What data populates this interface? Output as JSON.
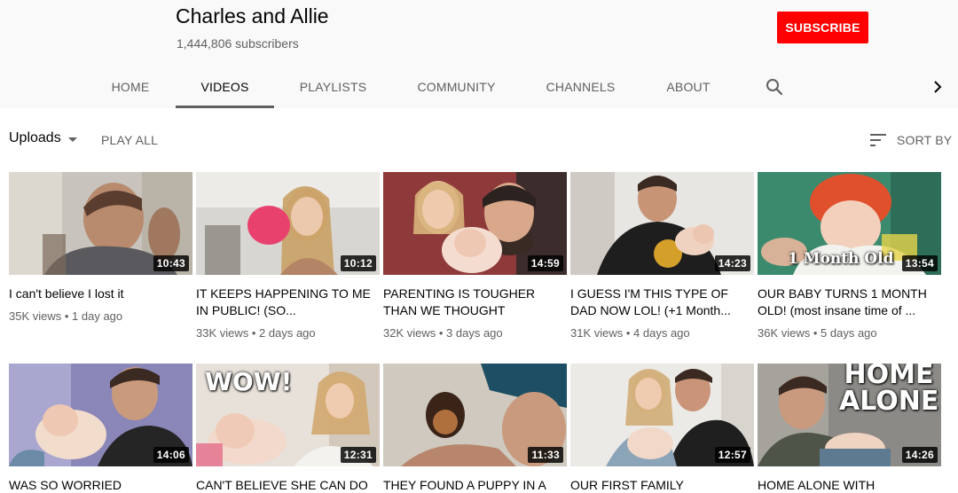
{
  "channel": {
    "name": "Charles and Allie",
    "subscribers": "1,444,806 subscribers",
    "subscribe_label": "SUBSCRIBE"
  },
  "tabs": [
    {
      "label": "HOME"
    },
    {
      "label": "VIDEOS"
    },
    {
      "label": "PLAYLISTS"
    },
    {
      "label": "COMMUNITY"
    },
    {
      "label": "CHANNELS"
    },
    {
      "label": "ABOUT"
    }
  ],
  "icons": {
    "search": "search-icon",
    "next": "chevron-right-icon",
    "sort": "sort-icon",
    "dropdown": "caret-down-icon"
  },
  "toolbar": {
    "uploads_label": "Uploads",
    "play_all_label": "PLAY ALL",
    "sort_label": "SORT BY"
  },
  "videos": [
    {
      "title": "I can't believe I lost it",
      "meta": "35K views • 1 day ago",
      "duration": "10:43",
      "overlay": ""
    },
    {
      "title": "IT KEEPS HAPPENING TO ME IN PUBLIC! (SO...",
      "meta": "33K views • 2 days ago",
      "duration": "10:12",
      "overlay": ""
    },
    {
      "title": "PARENTING IS TOUGHER THAN WE THOUGHT",
      "meta": "32K views • 3 days ago",
      "duration": "14:59",
      "overlay": ""
    },
    {
      "title": "I GUESS I'M THIS TYPE OF DAD NOW LOL! (+1 Month...",
      "meta": "31K views • 4 days ago",
      "duration": "14:23",
      "overlay": ""
    },
    {
      "title": "OUR BABY TURNS 1 MONTH OLD! (most insane time of ...",
      "meta": "36K views • 5 days ago",
      "duration": "13:54",
      "overlay": "1 Month Old"
    },
    {
      "title": "WAS SO WORRIED",
      "meta": "",
      "duration": "14:06",
      "overlay": ""
    },
    {
      "title": "CAN'T BELIEVE SHE CAN DO",
      "meta": "",
      "duration": "12:31",
      "overlay": "WOW!"
    },
    {
      "title": "THEY FOUND A PUPPY IN A",
      "meta": "",
      "duration": "11:33",
      "overlay": ""
    },
    {
      "title": "OUR FIRST FAMILY",
      "meta": "",
      "duration": "12:57",
      "overlay": ""
    },
    {
      "title": "HOME ALONE WITH",
      "meta": "",
      "duration": "14:26",
      "overlay": "HOME ALONE"
    }
  ],
  "colors": {
    "accent": "#ff0000",
    "text_secondary": "#606060",
    "header_bg": "#f9f9f9"
  }
}
